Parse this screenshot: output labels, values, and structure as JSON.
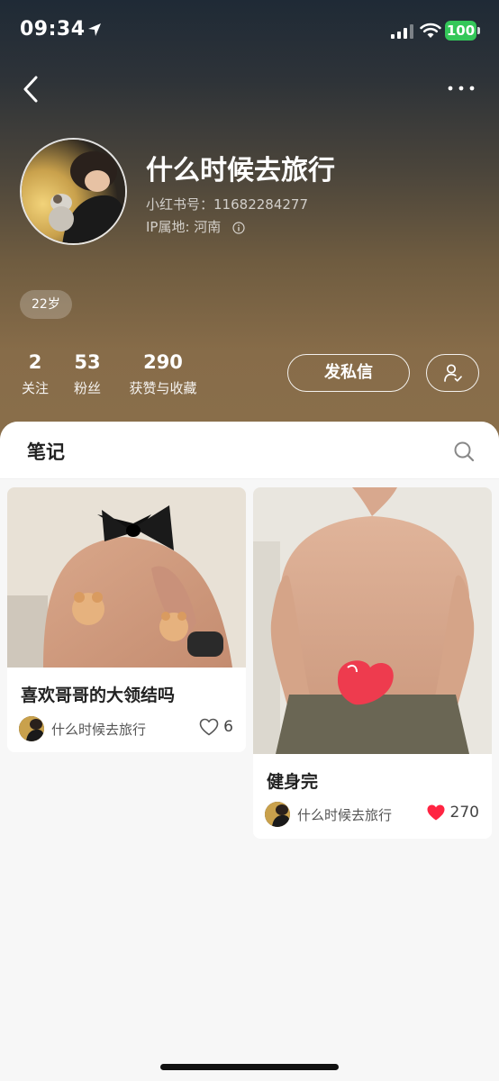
{
  "status_bar": {
    "time": "09:34",
    "battery": "100",
    "battery_color": "#34c759"
  },
  "nav": {
    "back_icon": "chevron-left-icon",
    "more_icon": "ellipsis-icon"
  },
  "profile": {
    "username": "什么时候去旅行",
    "red_id_label": "小红书号：",
    "red_id": "11682284277",
    "ip_label": "IP属地: ",
    "ip_location": "河南",
    "age_badge": "22岁"
  },
  "stats": [
    {
      "value": "2",
      "label": "关注"
    },
    {
      "value": "53",
      "label": "粉丝"
    },
    {
      "value": "290",
      "label": "获赞与收藏"
    }
  ],
  "actions": {
    "message_label": "发私信",
    "follow_icon": "user-check-icon"
  },
  "tabs": {
    "notes_label": "笔记",
    "search_icon": "search-icon"
  },
  "posts": [
    {
      "title": "喜欢哥哥的大领结吗",
      "author": "什么时候去旅行",
      "likes": "6",
      "liked": false
    },
    {
      "title": "健身完",
      "author": "什么时候去旅行",
      "likes": "270",
      "liked": true
    }
  ],
  "colors": {
    "like_red": "#ff2442",
    "brand_gradient_top": "#1f2a36",
    "brand_gradient_bottom": "#8a6f4b"
  }
}
